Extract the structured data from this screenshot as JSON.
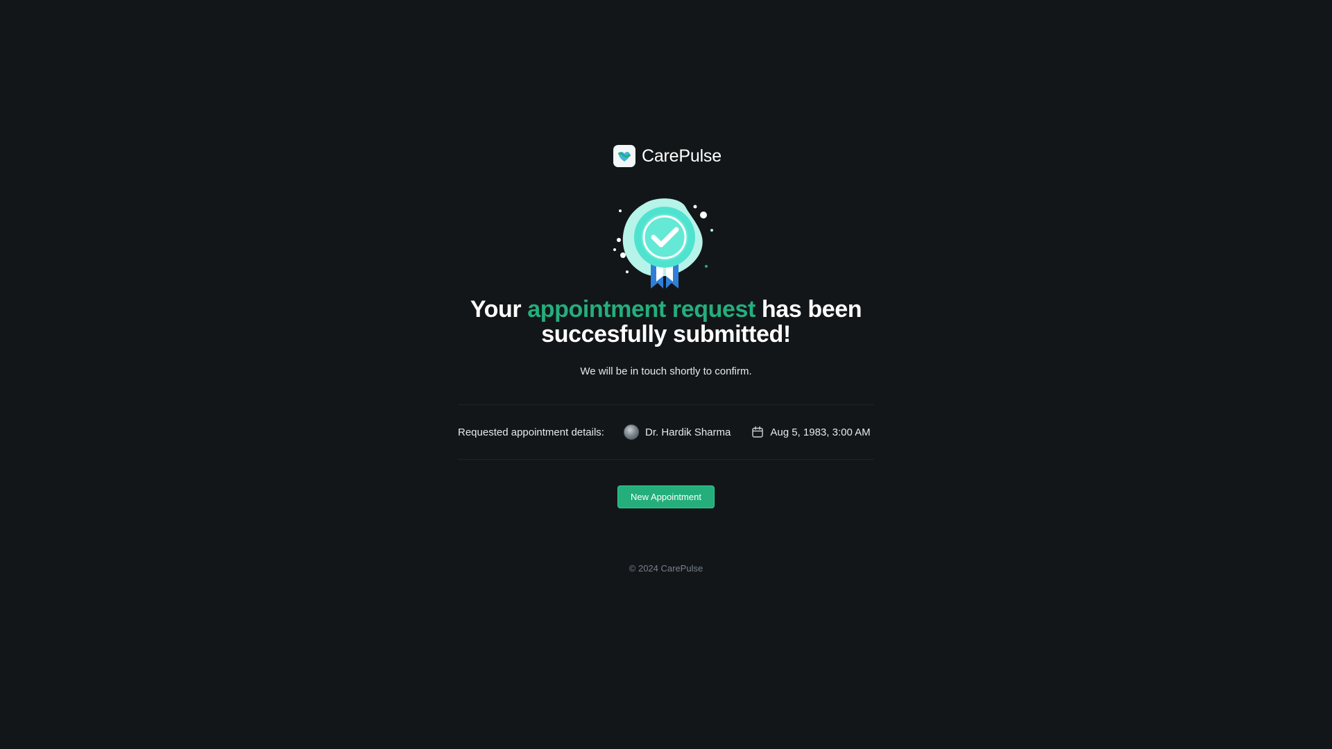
{
  "brand": {
    "name": "CarePulse",
    "logo_icon": "carepulse-logo-icon",
    "accent_color": "#24ae7c"
  },
  "success": {
    "badge_icon": "verified-badge-icon",
    "headline_prefix": "Your ",
    "headline_accent": "appointment request",
    "headline_suffix": " has been succesfully submitted!",
    "subtext": "We will be in touch shortly to confirm."
  },
  "details": {
    "label": "Requested appointment details:",
    "doctor_name": "Dr. Hardik Sharma",
    "datetime": "Aug 5, 1983, 3:00 AM",
    "calendar_icon": "calendar-icon"
  },
  "actions": {
    "new_appointment_label": "New Appointment"
  },
  "footer": {
    "copyright": "© 2024 CarePulse"
  }
}
